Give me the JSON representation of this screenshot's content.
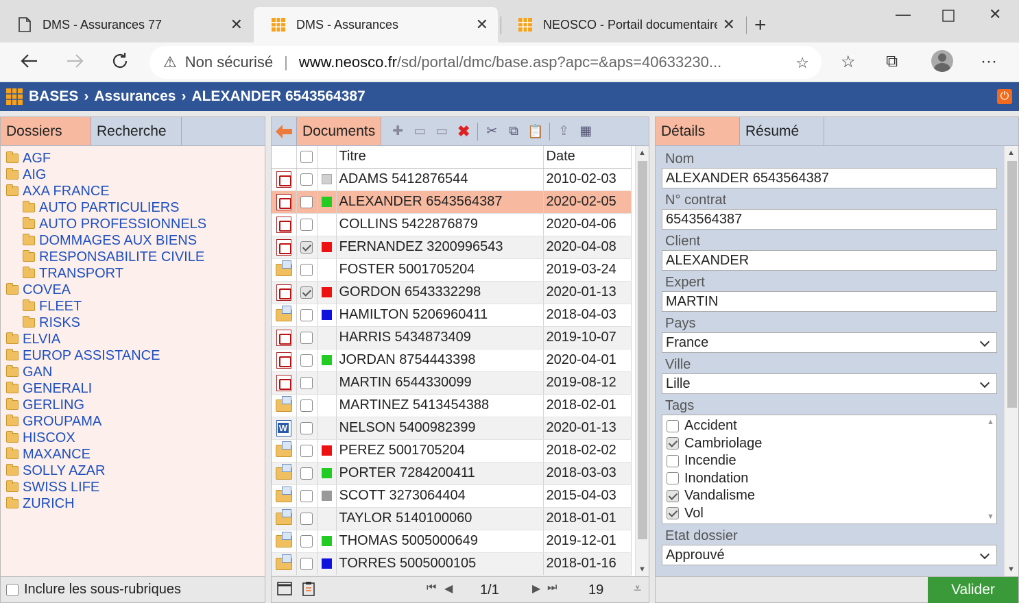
{
  "browser": {
    "tabs": [
      {
        "title": "DMS - Assurances 77",
        "icon": "document-icon"
      },
      {
        "title": "DMS - Assurances",
        "icon": "app-grid-icon",
        "active": true
      },
      {
        "title": "NEOSCO - Portail documentaire",
        "icon": "app-grid-icon"
      }
    ],
    "address": {
      "security_label": "Non sécurisé",
      "url_host": "www.neosco.fr",
      "url_rest": "/sd/portal/dmc/base.asp?apc=&aps=40633230..."
    }
  },
  "header": {
    "crumbs": [
      "BASES",
      "Assurances",
      "ALEXANDER 6543564387"
    ],
    "accent": "#2f5597"
  },
  "left": {
    "tabs": [
      "Dossiers",
      "Recherche"
    ],
    "tree": [
      {
        "label": "AGF",
        "level": 0
      },
      {
        "label": "AIG",
        "level": 0
      },
      {
        "label": "AXA FRANCE",
        "level": 0
      },
      {
        "label": "AUTO PARTICULIERS",
        "level": 1
      },
      {
        "label": "AUTO PROFESSIONNELS",
        "level": 1
      },
      {
        "label": "DOMMAGES AUX BIENS",
        "level": 1
      },
      {
        "label": "RESPONSABILITE CIVILE",
        "level": 1
      },
      {
        "label": "TRANSPORT",
        "level": 1
      },
      {
        "label": "COVEA",
        "level": 0
      },
      {
        "label": "FLEET",
        "level": 1
      },
      {
        "label": "RISKS",
        "level": 1
      },
      {
        "label": "ELVIA",
        "level": 0
      },
      {
        "label": "EUROP ASSISTANCE",
        "level": 0
      },
      {
        "label": "GAN",
        "level": 0
      },
      {
        "label": "GENERALI",
        "level": 0
      },
      {
        "label": "GERLING",
        "level": 0
      },
      {
        "label": "GROUPAMA",
        "level": 0
      },
      {
        "label": "HISCOX",
        "level": 0
      },
      {
        "label": "MAXANCE",
        "level": 0
      },
      {
        "label": "SOLLY AZAR",
        "level": 0
      },
      {
        "label": "SWISS LIFE",
        "level": 0
      },
      {
        "label": "ZURICH",
        "level": 0
      }
    ],
    "include_sub_label": "Inclure les sous-rubriques"
  },
  "middle": {
    "tab_label": "Documents",
    "columns": {
      "title": "Titre",
      "date": "Date"
    },
    "rows": [
      {
        "type": "pdf",
        "checked": false,
        "tag": "#d0d0d0",
        "title": "ADAMS 5412876544",
        "date": "2010-02-03"
      },
      {
        "type": "pdf",
        "checked": false,
        "tag": "#22cc22",
        "title": "ALEXANDER 6543564387",
        "date": "2020-02-05",
        "selected": true
      },
      {
        "type": "pdf",
        "checked": false,
        "tag": "",
        "title": "COLLINS 5422876879",
        "date": "2020-04-06"
      },
      {
        "type": "pdf",
        "checked": true,
        "tag": "#ee1111",
        "title": "FERNANDEZ 3200996543",
        "date": "2020-04-08"
      },
      {
        "type": "folder",
        "checked": false,
        "tag": "",
        "title": "FOSTER 5001705204",
        "date": "2019-03-24"
      },
      {
        "type": "pdf",
        "checked": true,
        "tag": "#ee1111",
        "title": "GORDON 6543332298",
        "date": "2020-01-13"
      },
      {
        "type": "folder",
        "checked": false,
        "tag": "#1111dd",
        "title": "HAMILTON 5206960411",
        "date": "2018-04-03"
      },
      {
        "type": "pdf",
        "checked": false,
        "tag": "",
        "title": "HARRIS 5434873409",
        "date": "2019-10-07"
      },
      {
        "type": "pdf",
        "checked": false,
        "tag": "#22cc22",
        "title": "JORDAN 8754443398",
        "date": "2020-04-01"
      },
      {
        "type": "pdf",
        "checked": false,
        "tag": "",
        "title": "MARTIN 6544330099",
        "date": "2019-08-12"
      },
      {
        "type": "folder",
        "checked": false,
        "tag": "",
        "title": "MARTINEZ 5413454388",
        "date": "2018-02-01"
      },
      {
        "type": "word",
        "checked": false,
        "tag": "",
        "title": "NELSON 5400982399",
        "date": "2020-01-13"
      },
      {
        "type": "folder",
        "checked": false,
        "tag": "#ee1111",
        "title": "PEREZ 5001705204",
        "date": "2018-02-02"
      },
      {
        "type": "folder",
        "checked": false,
        "tag": "#22cc22",
        "title": "PORTER 7284200411",
        "date": "2018-03-03"
      },
      {
        "type": "folder",
        "checked": false,
        "tag": "#999999",
        "title": "SCOTT 3273064404",
        "date": "2015-04-03"
      },
      {
        "type": "folder",
        "checked": false,
        "tag": "",
        "title": "TAYLOR 5140100060",
        "date": "2018-01-01"
      },
      {
        "type": "folder",
        "checked": false,
        "tag": "#22cc22",
        "title": "THOMAS 5005000649",
        "date": "2019-12-01"
      },
      {
        "type": "folder",
        "checked": false,
        "tag": "#1111dd",
        "title": "TORRES 5005000105",
        "date": "2018-01-16"
      }
    ],
    "pagination": {
      "page": "1/1",
      "count": "19"
    }
  },
  "right": {
    "tabs": [
      "Détails",
      "Résumé"
    ],
    "fields": {
      "nom": {
        "label": "Nom",
        "value": "ALEXANDER 6543564387"
      },
      "contrat": {
        "label": "N° contrat",
        "value": "6543564387"
      },
      "client": {
        "label": "Client",
        "value": "ALEXANDER"
      },
      "expert": {
        "label": "Expert",
        "value": "MARTIN"
      },
      "pays": {
        "label": "Pays",
        "value": "France"
      },
      "ville": {
        "label": "Ville",
        "value": "Lille"
      },
      "tags_label": "Tags",
      "etat": {
        "label": "Etat dossier",
        "value": "Approuvé"
      }
    },
    "tags": [
      {
        "label": "Accident",
        "checked": false
      },
      {
        "label": "Cambriolage",
        "checked": true
      },
      {
        "label": "Incendie",
        "checked": false
      },
      {
        "label": "Inondation",
        "checked": false
      },
      {
        "label": "Vandalisme",
        "checked": true
      },
      {
        "label": "Vol",
        "checked": true
      }
    ],
    "submit_label": "Valider"
  }
}
